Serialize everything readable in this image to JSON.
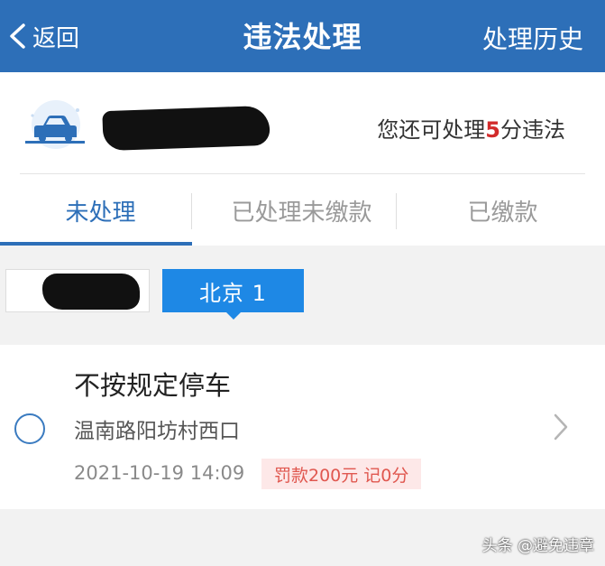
{
  "header": {
    "back_label": "返回",
    "title": "违法处理",
    "history_label": "处理历史"
  },
  "user": {
    "quota_prefix": "您还可处理",
    "quota_points": "5",
    "quota_suffix": "分违法"
  },
  "tabs": [
    {
      "label": "未处理"
    },
    {
      "label": "已处理未缴款"
    },
    {
      "label": "已缴款"
    }
  ],
  "plates": {
    "selected_label": "北京 1"
  },
  "violation": {
    "title": "不按规定停车",
    "address": "温南路阳坊村西口",
    "datetime": "2021-10-19 14:09",
    "fine": "罚款200元 记0分"
  },
  "watermark": "头条 @避免违章",
  "colors": {
    "header_bg": "#2d6fb8",
    "accent": "#2d6fb8",
    "plate_chip": "#1e88e5",
    "points_highlight": "#d22b2b",
    "fine_text": "#e0574f",
    "fine_bg": "#fde8e8"
  }
}
